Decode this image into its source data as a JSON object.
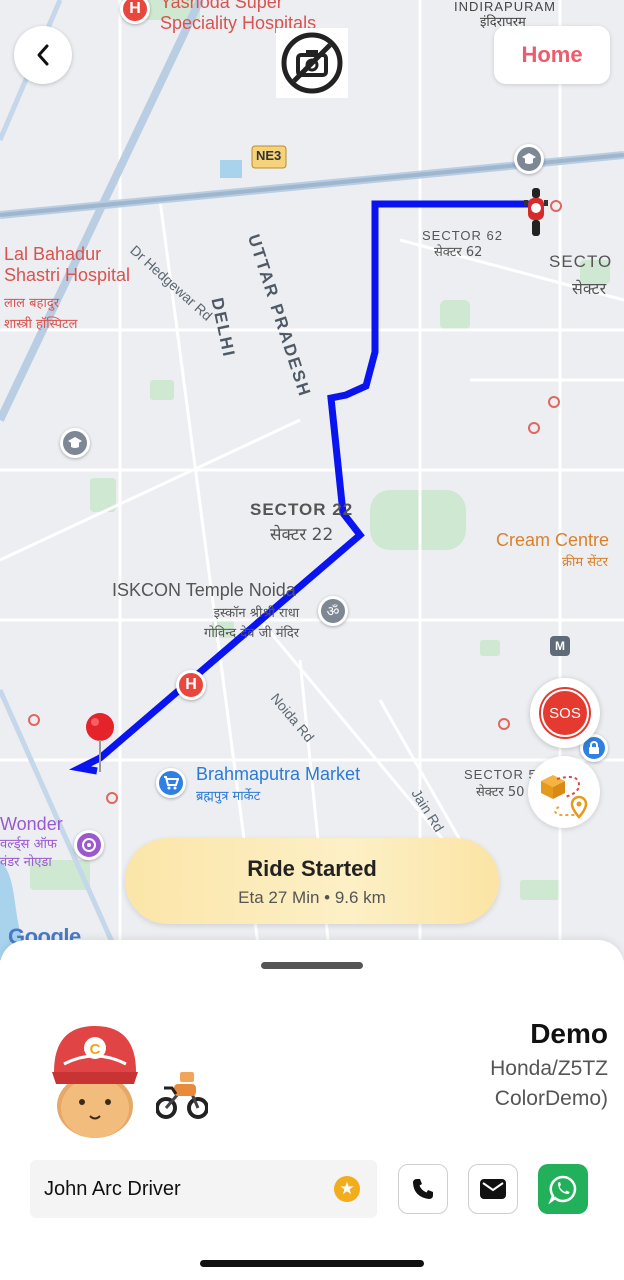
{
  "top_bar": {
    "home_label": "Home"
  },
  "map": {
    "pois": {
      "hospital_top": "Yashoda Super\nSpeciality Hospitals",
      "indirapuram": "INDIRAPURAM",
      "indirapuram_hi": "इंदिरापुरम",
      "lal_bahadur": "Lal Bahadur\nShastri Hospital",
      "lal_bahadur_hi": "लाल बहादुर\nशास्त्री हॉस्पिटल",
      "cream_centre": "Cream Centre",
      "cream_centre_hi": "क्रीम सेंटर",
      "iskcon": "ISKCON Temple Noida",
      "iskcon_hi": "इस्कॉन श्रीश्री राधा\nगोविन्द देव जी मंदिर",
      "brahmaputra": "Brahmaputra Market",
      "brahmaputra_hi": "ब्रह्मपुत्र मार्केट",
      "wonder": "Wonder",
      "wonder_hi": "वर्ल्ड्स ऑफ\nवंडर नोएडा"
    },
    "sectors": {
      "sector62": "SECTOR 62",
      "sector62_hi": "सेक्टर 62",
      "sector_right": "SECTO",
      "sector_right_hi": "सेक्टर",
      "sector22": "SECTOR 22",
      "sector22_hi": "सेक्टर 22",
      "sector50": "SECTOR 5",
      "sector50_hi": "सेक्टर 50"
    },
    "roads": {
      "hedgewar": "Dr Hedgewar Rd",
      "noida_rd": "Noida Rd",
      "jain_rd": "Jain Rd",
      "ne3": "NE3"
    },
    "areas": {
      "uttar_pradesh": "UTTAR PRADESH",
      "delhi": "DELHI"
    },
    "metro": "M",
    "hospital_marker": "H",
    "attribution": "Google",
    "route_color": "#0a14f0"
  },
  "sos_label": "SOS",
  "ride_status": {
    "title": "Ride Started",
    "eta": "Eta 27 Min • 9.6 km"
  },
  "vehicle": {
    "name": "Demo",
    "model_line1": "Honda/Z5TZ",
    "model_line2": "ColorDemo)"
  },
  "driver": {
    "name": "John Arc Driver",
    "rating_icon": "star-icon"
  },
  "actions": {
    "call_icon": "phone-icon",
    "message_icon": "mail-icon",
    "whatsapp_icon": "whatsapp-icon"
  }
}
